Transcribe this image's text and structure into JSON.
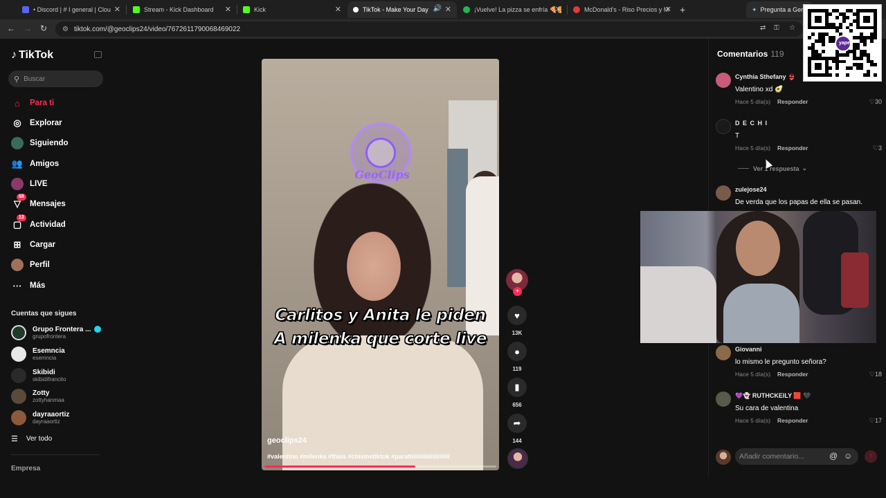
{
  "browser": {
    "tabs": [
      {
        "label": "• Discord | # I general | Clou",
        "favicon": "#5865f2",
        "active": false
      },
      {
        "label": "Stream - Kick Dashboard",
        "favicon": "#53fc18",
        "active": false
      },
      {
        "label": "Kick",
        "favicon": "#53fc18",
        "active": false
      },
      {
        "label": "TikTok - Make Your Day",
        "favicon": "#ffffff",
        "active": true
      },
      {
        "label": "¡Vuelve! La pizza se enfría 🍕🍔",
        "favicon": "#1db954",
        "active": false
      },
      {
        "label": "McDonald's - Riso Precios y M",
        "favicon": "#e53935",
        "active": false
      }
    ],
    "gemini_tab": "Pregunta a Gemi",
    "url": "tiktok.com/@geoclips24/video/7672611790068469022"
  },
  "sidebar": {
    "logo": "TikTok",
    "search_placeholder": "Buscar",
    "nav": [
      {
        "label": "Para ti",
        "icon": "home-icon",
        "active": true
      },
      {
        "label": "Explorar",
        "icon": "compass-icon"
      },
      {
        "label": "Siguiendo",
        "icon": "following-avatar-icon"
      },
      {
        "label": "Amigos",
        "icon": "friends-icon"
      },
      {
        "label": "LIVE",
        "icon": "live-icon"
      },
      {
        "label": "Mensajes",
        "icon": "messages-icon",
        "badge": "68"
      },
      {
        "label": "Actividad",
        "icon": "activity-icon",
        "badge": "13"
      },
      {
        "label": "Cargar",
        "icon": "upload-icon"
      },
      {
        "label": "Perfil",
        "icon": "profile-icon"
      },
      {
        "label": "Más",
        "icon": "more-icon"
      }
    ],
    "following_title": "Cuentas que sigues",
    "following": [
      {
        "name": "Grupo Frontera ...",
        "handle": "grupofrontera",
        "verified": true,
        "color": "#1f3a2a"
      },
      {
        "name": "Esemncia",
        "handle": "esemncia",
        "color": "#e8e8e8"
      },
      {
        "name": "Skibidi",
        "handle": "skibidifrancito",
        "color": "#6b6b6b"
      },
      {
        "name": "Zotty",
        "handle": "zottyhanmaa",
        "color": "#3a3a3a"
      },
      {
        "name": "dayraaortiz",
        "handle": "dayraaortiz",
        "color": "#8a5a3a"
      }
    ],
    "see_all": "Ver todo",
    "footer": "Empresa"
  },
  "video": {
    "watermark": "GeoClips",
    "caption_line1": "Carlitos y Anita le piden",
    "caption_line2": "A milenka que corte live",
    "username": "geoclips24",
    "hashtags": "#valentino #milenka #thais #chismetiktok #paratiiiiiiiiiiiiiiiiiiiiiii",
    "progress": 0.65
  },
  "actions": {
    "likes": "13K",
    "comments": "119",
    "saves": "656",
    "shares": "144"
  },
  "comments": {
    "title": "Comentarios",
    "count": "119",
    "reply_label": "Responder",
    "items": [
      {
        "name": "Cynthia Sthefany 👙",
        "text": "Valentino xd 🥑",
        "time": "Hace 5 día(s)",
        "likes": "30",
        "color": "#c75b7a"
      },
      {
        "name": "D E C H I",
        "text": "T",
        "time": "Hace 5 día(s)",
        "likes": "3",
        "color": "#111111"
      },
      {
        "name": "zulejose24",
        "text": "De verda que los papas de ella se pasan.",
        "time": "",
        "likes": "",
        "color": "#7a5a4a"
      },
      {
        "name": "Giovanni",
        "text": "lo mismo le pregunto señora?",
        "time": "Hace 5 día(s)",
        "likes": "18",
        "color": "#8a6a4a"
      },
      {
        "name": "💜👻 RUTHCKEILY 🟥 🖤",
        "text": "Su cara de valentina",
        "time": "Hace 5 día(s)",
        "likes": "17",
        "color": "#5a5a4a"
      }
    ],
    "view_replies": "Ver 1 respuesta",
    "input_placeholder": "Añadir comentario..."
  },
  "overlays": {
    "qr_label": "yape"
  }
}
